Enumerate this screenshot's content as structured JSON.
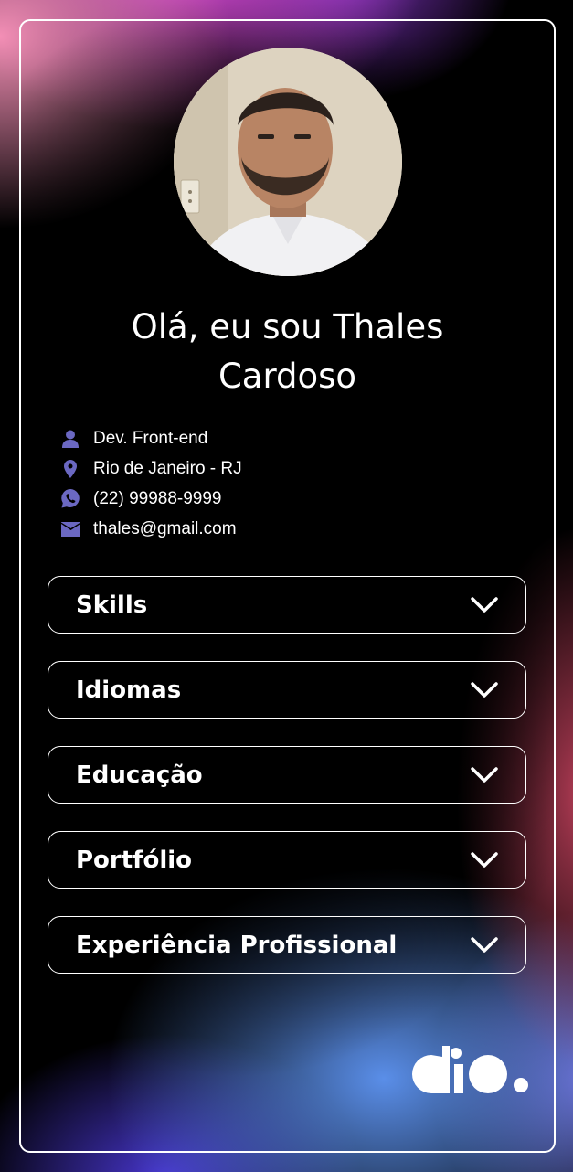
{
  "profile": {
    "greeting": "Olá, eu sou Thales Cardoso",
    "info": [
      {
        "icon": "user-icon",
        "text": "Dev. Front-end"
      },
      {
        "icon": "location-pin-icon",
        "text": "Rio de Janeiro - RJ"
      },
      {
        "icon": "whatsapp-icon",
        "text": "(22) 99988-9999"
      },
      {
        "icon": "email-icon",
        "text": "thales@gmail.com"
      }
    ]
  },
  "sections": [
    {
      "label": "Skills"
    },
    {
      "label": "Idiomas"
    },
    {
      "label": "Educação"
    },
    {
      "label": "Portfólio"
    },
    {
      "label": "Experiência Profissional"
    }
  ],
  "colors": {
    "icon": "#6b68c2",
    "text": "#ffffff",
    "border": "#ffffff"
  },
  "brand": {
    "logo": "dio-logo"
  }
}
